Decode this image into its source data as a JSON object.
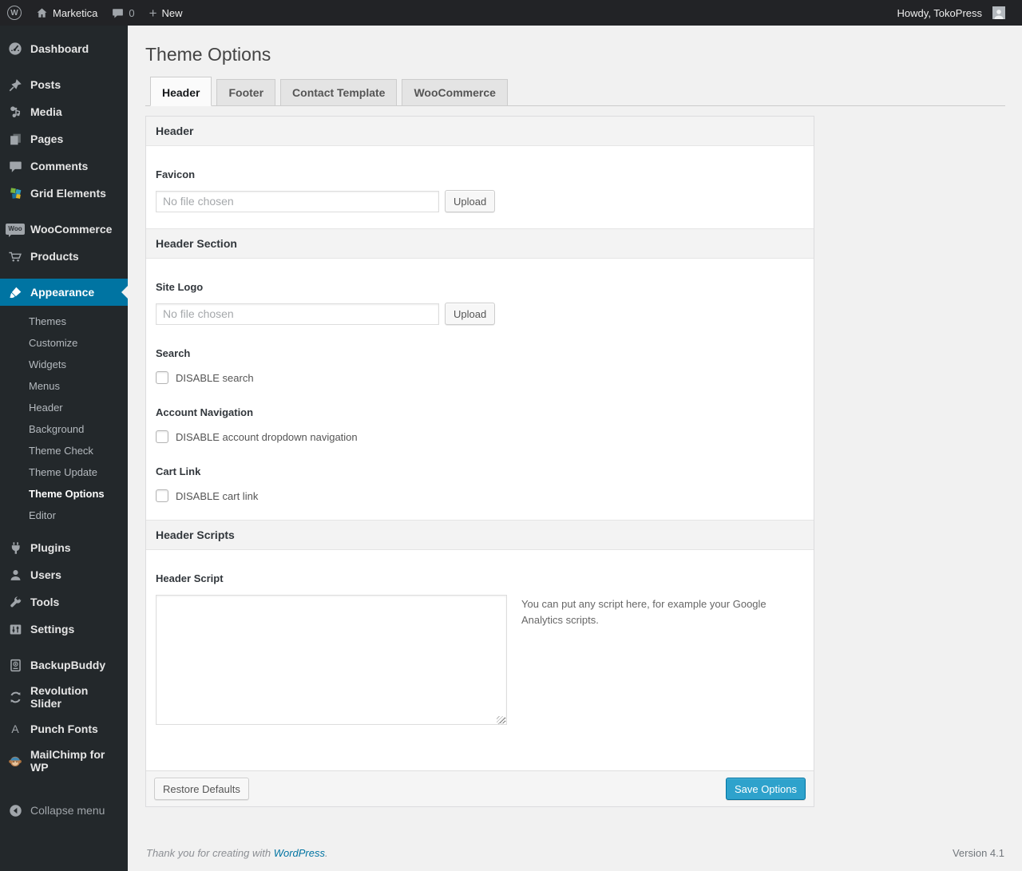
{
  "colors": {
    "menu_highlight": "#0074a2",
    "primary_button": "#2ea2cc",
    "admin_bar_bg": "#222326",
    "sidebar_bg": "#23282b",
    "page_bg": "#f1f1f1"
  },
  "admin_bar": {
    "site_name": "Marketica",
    "comments_count": "0",
    "new_label": "New",
    "howdy_text": "Howdy, TokoPress"
  },
  "sidebar": {
    "dashboard": "Dashboard",
    "posts": "Posts",
    "media": "Media",
    "pages": "Pages",
    "comments": "Comments",
    "grid_elements": "Grid Elements",
    "woocommerce": "WooCommerce",
    "woo_badge": "Woo",
    "products": "Products",
    "appearance": "Appearance",
    "submenu": {
      "themes": "Themes",
      "customize": "Customize",
      "widgets": "Widgets",
      "menus": "Menus",
      "header": "Header",
      "background": "Background",
      "theme_check": "Theme Check",
      "theme_update": "Theme Update",
      "theme_options": "Theme Options",
      "editor": "Editor"
    },
    "plugins": "Plugins",
    "users": "Users",
    "tools": "Tools",
    "settings": "Settings",
    "backupbuddy": "BackupBuddy",
    "revolution_slider": "Revolution Slider",
    "punch_fonts": "Punch Fonts",
    "punch_fonts_glyph": "A",
    "mailchimp": "MailChimp for WP",
    "collapse_menu": "Collapse menu"
  },
  "page": {
    "title": "Theme Options",
    "tabs": {
      "header": "Header",
      "footer": "Footer",
      "contact_template": "Contact Template",
      "woocommerce": "WooCommerce"
    }
  },
  "panel": {
    "section_header": "Header",
    "favicon": {
      "label": "Favicon",
      "file_placeholder": "No file chosen",
      "upload_label": "Upload"
    },
    "section_header_section": "Header Section",
    "site_logo": {
      "label": "Site Logo",
      "file_placeholder": "No file chosen",
      "upload_label": "Upload"
    },
    "search": {
      "label": "Search",
      "checkbox_label": "DISABLE search",
      "checked": false
    },
    "account_navigation": {
      "label": "Account Navigation",
      "checkbox_label": "DISABLE account dropdown navigation",
      "checked": false
    },
    "cart_link": {
      "label": "Cart Link",
      "checkbox_label": "DISABLE cart link",
      "checked": false
    },
    "section_header_scripts": "Header Scripts",
    "header_script": {
      "label": "Header Script",
      "value": "",
      "help_text": "You can put any script here, for example your Google Analytics scripts."
    },
    "actions": {
      "restore_label": "Restore Defaults",
      "save_label": "Save Options"
    }
  },
  "footer": {
    "thanks_prefix": "Thank you for creating with",
    "wordpress_link": "WordPress",
    "thanks_suffix": ".",
    "version": "Version 4.1"
  }
}
